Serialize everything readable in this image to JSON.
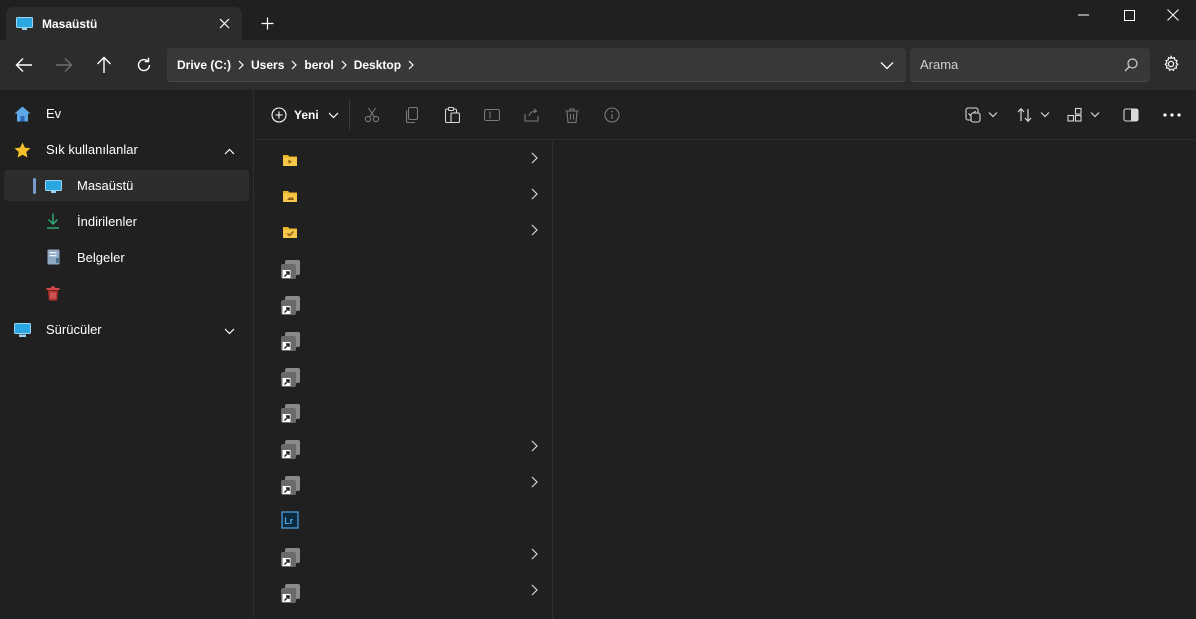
{
  "tab": {
    "title": "Masaüstü",
    "close_icon": "close-icon",
    "new_tab_icon": "plus-icon"
  },
  "window_controls": [
    "minimize-icon",
    "maximize-icon",
    "close-icon"
  ],
  "breadcrumb": [
    "Drive (C:)",
    "Users",
    "berol",
    "Desktop"
  ],
  "search": {
    "placeholder": "Arama"
  },
  "sidebar": {
    "home": "Ev",
    "favorites": "Sık kullanılanlar",
    "items": [
      {
        "label": "Masaüstü",
        "icon": "desktop-icon",
        "selected": true
      },
      {
        "label": "İndirilenler",
        "icon": "download-icon"
      },
      {
        "label": "Belgeler",
        "icon": "document-icon"
      },
      {
        "label": "",
        "icon": "recycle-bin-icon"
      }
    ],
    "drives": "Sürücüler"
  },
  "toolbar": {
    "new_label": "Yeni",
    "actions": [
      "cut-icon",
      "copy-icon",
      "paste-icon",
      "rename-icon",
      "share-icon",
      "delete-icon",
      "info-icon"
    ],
    "right_actions": [
      "select-icon",
      "sort-icon",
      "view-icon",
      "details-pane-icon",
      "more-icon"
    ]
  },
  "file_rows": [
    {
      "icon": "folder-media-icon",
      "has_children": true
    },
    {
      "icon": "folder-image-icon",
      "has_children": true
    },
    {
      "icon": "folder-check-icon",
      "has_children": true
    },
    {
      "icon": "shortcut-icon",
      "has_children": false
    },
    {
      "icon": "shortcut-icon",
      "has_children": false
    },
    {
      "icon": "shortcut-icon",
      "has_children": false
    },
    {
      "icon": "shortcut-icon",
      "has_children": false
    },
    {
      "icon": "shortcut-icon",
      "has_children": false
    },
    {
      "icon": "shortcut-icon",
      "has_children": true
    },
    {
      "icon": "shortcut-icon",
      "has_children": true
    },
    {
      "icon": "lightroom-icon",
      "has_children": false,
      "badge": "Lr"
    },
    {
      "icon": "shortcut-icon",
      "has_children": true
    },
    {
      "icon": "shortcut-icon",
      "has_children": true
    }
  ],
  "colors": {
    "accent": "#7a9bc9",
    "folder": "#e8b22a",
    "trash": "#c0393b",
    "lightroom": "#4fa7e6"
  }
}
